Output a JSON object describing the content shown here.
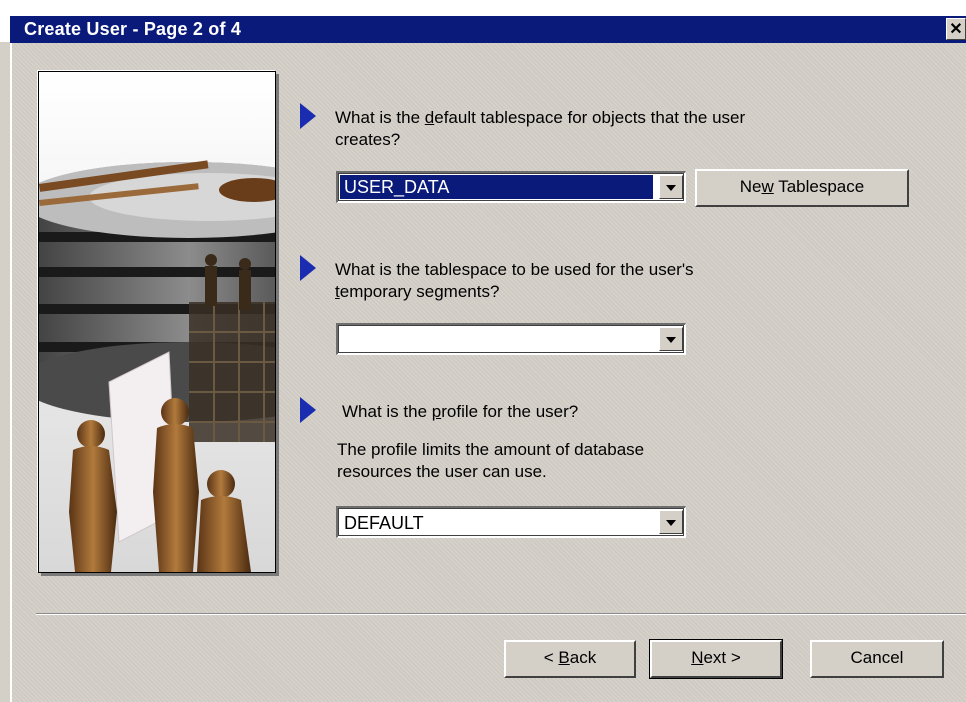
{
  "window": {
    "title": "Create User - Page 2 of 4",
    "close_glyph": "✕"
  },
  "questions": [
    {
      "pre": "What is the ",
      "mnemonic": "d",
      "post": "efault tablespace for objects that the user",
      "line2": "creates?",
      "combo_value": "USER_DATA",
      "combo_selected": true
    },
    {
      "line1": "What is the tablespace to be used for the user's",
      "line2_mnemonic": "t",
      "line2_post": "emporary segments?",
      "combo_value": ""
    },
    {
      "pre": "What is the ",
      "mnemonic": "p",
      "post": "rofile for the user?",
      "desc1": "The profile limits the amount of database",
      "desc2": "resources the user can use.",
      "combo_value": "DEFAULT"
    }
  ],
  "buttons": {
    "new_tablespace": {
      "pre": "Ne",
      "mnemonic": "w",
      "post": " Tablespace"
    },
    "back": {
      "pre": "< ",
      "mnemonic": "B",
      "post": "ack"
    },
    "next": {
      "pre": "",
      "mnemonic": "N",
      "post": "ext >"
    },
    "cancel": "Cancel"
  },
  "colors": {
    "titlebar": "#0a1a7a",
    "arrow": "#1a2db0",
    "dialog": "#d4d0c8"
  },
  "icons": {
    "question_marker": "blue-arrow-icon",
    "dropdown": "chevron-down-icon",
    "close": "close-icon"
  }
}
